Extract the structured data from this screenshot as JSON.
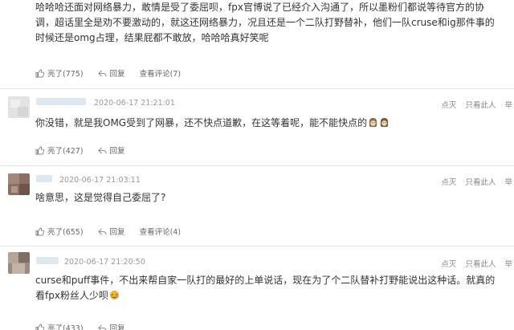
{
  "comment0": {
    "lines": [
      "哈哈哈还面对网络暴力，敢情是受了委屈呗，fpx官博说了已经介入沟通了，所以墨粉们都说等待官方的协",
      "调，超话里全是劝不要激动的，就这还网络暴力，况且还是一个二队打野替补，他们一队cruse和ig那件事的",
      "时候还是omg占理，结果屁都不敢放，哈哈哈真好笑呢"
    ],
    "like": "亮了(775)",
    "reply": "回复",
    "view": "查看评论(7)"
  },
  "comment1": {
    "time": "2020-06-17 21:21:01",
    "text": "你没错，就是我OMG受到了网暴，还不快点道歉，在这等着呢，能不能快点的",
    "like": "亮了(427)",
    "reply": "回复",
    "dislike": "点灭",
    "only_author": "只看此人",
    "more": "举"
  },
  "comment2": {
    "time": "2020-06-17 21:03:11",
    "text": "啥意思，这是觉得自己委屈了?",
    "like": "亮了(655)",
    "reply": "回复",
    "view": "查看评论(4)",
    "dislike": "点灭",
    "only_author": "只看此人",
    "more": "举"
  },
  "comment3": {
    "time": "2020-06-17 21:20:50",
    "lines": [
      "curse和puff事件，不出来帮自家一队打的最好的上单说话，现在为了个二队替补打野能说出这种话。就真的",
      "看fpx粉丝人少呗"
    ],
    "like": "亮了(433)",
    "reply": "回复",
    "dislike": "点灭",
    "only_author": "只看此人",
    "more": "举"
  },
  "icons": {
    "like": "thumb-up-icon",
    "reply": "reply-arrow-icon",
    "emoji": "face-emoji-icon"
  }
}
